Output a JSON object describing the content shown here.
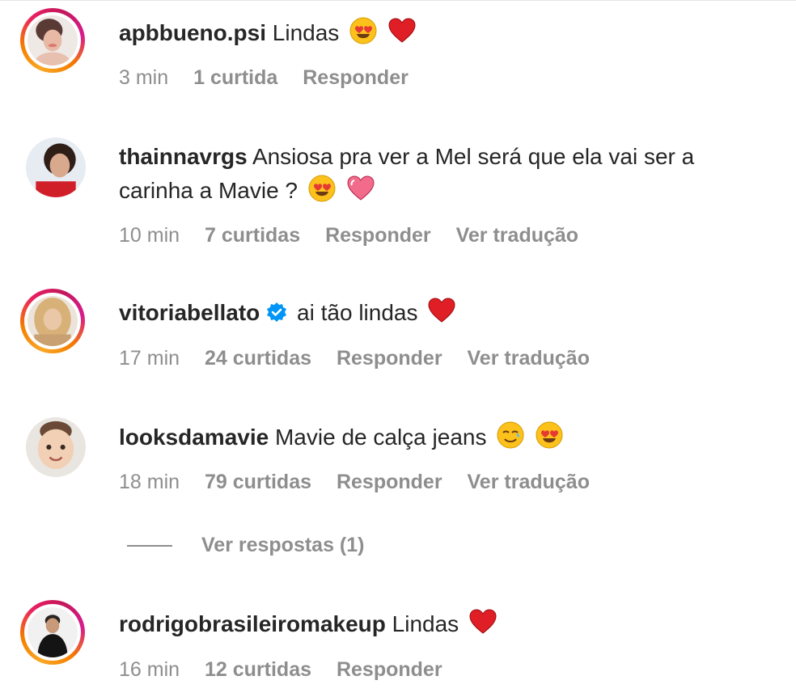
{
  "comments": [
    {
      "username": "apbbueno.psi",
      "text": "Lindas",
      "emojis": [
        "heart-eyes-emoji",
        "red-heart-emoji"
      ],
      "time": "3 min",
      "likes": "1 curtida",
      "reply": "Responder",
      "translate": ""
    },
    {
      "username": "thainnavrgs",
      "text": "Ansiosa pra ver a Mel será que ela vai ser a carinha a Mavie ?",
      "emojis": [
        "heart-eyes-emoji",
        "pink-heart-emoji"
      ],
      "time": "10 min",
      "likes": "7 curtidas",
      "reply": "Responder",
      "translate": "Ver tradução"
    },
    {
      "username": "vitoriabellato",
      "verified": true,
      "text": "ai tão lindas",
      "emojis": [
        "red-heart-emoji"
      ],
      "time": "17 min",
      "likes": "24 curtidas",
      "reply": "Responder",
      "translate": "Ver tradução"
    },
    {
      "username": "looksdamavie",
      "text": "Mavie de calça jeans",
      "emojis": [
        "smiling-tear-emoji",
        "heart-eyes-emoji"
      ],
      "time": "18 min",
      "likes": "79 curtidas",
      "reply": "Responder",
      "translate": "Ver tradução",
      "view_replies": "Ver respostas (1)"
    },
    {
      "username": "rodrigobrasileiromakeup",
      "text": "Lindas",
      "emojis": [
        "red-heart-emoji"
      ],
      "time": "16 min",
      "likes": "12 curtidas",
      "reply": "Responder",
      "translate": ""
    }
  ],
  "colors": {
    "text": "#262626",
    "meta": "#8e8e8e",
    "verified": "#0095f6",
    "story_ring_start": "#f9a825",
    "story_ring_end": "#d81b90"
  }
}
